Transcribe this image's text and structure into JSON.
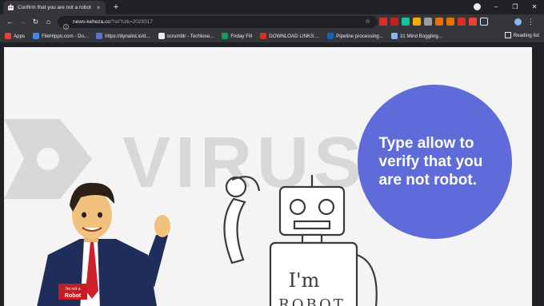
{
  "browser": {
    "tab": {
      "title": "Confirm that you are not a robot",
      "close_glyph": "×"
    },
    "new_tab_glyph": "+",
    "window_controls": {
      "minimize": "–",
      "maximize": "❐",
      "close": "✕"
    },
    "nav": {
      "back": "←",
      "forward": "→",
      "reload": "↻",
      "home": "⌂"
    },
    "address": {
      "domain": "news-keheza.cc",
      "path": "/?sl/?utk=2029317"
    },
    "star_glyph": "☆",
    "menu_glyph": "⋮",
    "extensions": [
      {
        "name": "adblock-extension-icon",
        "color": "#d93025"
      },
      {
        "name": "ext-red-icon",
        "color": "#c5221f"
      },
      {
        "name": "grammarly-icon",
        "color": "#15c39a"
      },
      {
        "name": "ext-yellow-icon",
        "color": "#f9ab00"
      },
      {
        "name": "ext-grey-icon",
        "color": "#9aa0a6"
      },
      {
        "name": "ext-orange-icon",
        "color": "#e8710a"
      },
      {
        "name": "ext-rss-icon",
        "color": "#e37400"
      },
      {
        "name": "ext-bug-icon",
        "color": "#d93025"
      },
      {
        "name": "ext-gmail-icon",
        "color": "#ea4335"
      },
      {
        "name": "puzzle-extensions-icon",
        "color": "#e8eaed"
      }
    ],
    "bookmarks": [
      {
        "label": "Apps",
        "icon": "apps-grid-icon",
        "color": "#ea4335"
      },
      {
        "label": "FileHippo.com - Do...",
        "icon": "filehippo-icon",
        "color": "#4285f4"
      },
      {
        "label": "https://dynalist.io/d...",
        "icon": "dynalist-icon",
        "color": "#5f6fd6"
      },
      {
        "label": "scrumblr - Techlose...",
        "icon": "scrumblr-icon",
        "color": "#e8eaed"
      },
      {
        "label": "Friday Fill",
        "icon": "friday-fill-icon",
        "color": "#0f9d58"
      },
      {
        "label": "DOWNLOAD LINKS:...",
        "icon": "download-links-icon",
        "color": "#d93025"
      },
      {
        "label": "Pipeline processing...",
        "icon": "linkedin-icon",
        "color": "#0a66c2"
      },
      {
        "label": "31 Mind Boggling...",
        "icon": "mind-boggling-icon",
        "color": "#8ab4f8"
      }
    ],
    "reading_list": "Reading list"
  },
  "page": {
    "bubble_text": "Type allow to verify that you are not robot.",
    "bubble_color": "#5e6bd8",
    "badge_text_top": "I'm not a",
    "badge_text_bottom": "Robot",
    "robot_chest_text": "I'm",
    "robot_chest_text_2": "ROBOT",
    "watermark_text": "VIRUS"
  }
}
